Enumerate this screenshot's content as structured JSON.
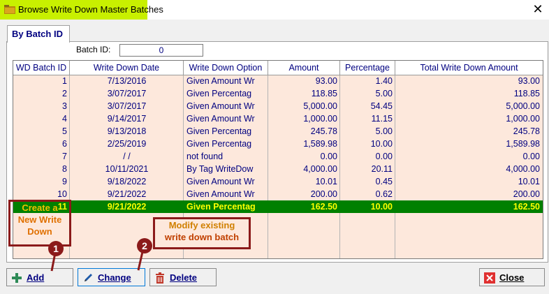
{
  "window": {
    "title": "Browse Write Down Master Batches",
    "close_symbol": "✕"
  },
  "tabs": [
    {
      "label": "By Batch ID",
      "active": true
    }
  ],
  "filter": {
    "batch_id_label": "Batch ID:",
    "batch_id_value": "0"
  },
  "grid": {
    "columns": [
      "WD Batch ID",
      "Write Down Date",
      "Write Down Option",
      "Amount",
      "Percentage",
      "Total Write Down Amount"
    ],
    "rows": [
      {
        "id": "1",
        "date": "7/13/2016",
        "option": "Given Amount Wr",
        "amount": "93.00",
        "percentage": "1.40",
        "total": "93.00"
      },
      {
        "id": "2",
        "date": "3/07/2017",
        "option": "Given Percentag",
        "amount": "118.85",
        "percentage": "5.00",
        "total": "118.85"
      },
      {
        "id": "3",
        "date": "3/07/2017",
        "option": "Given Amount Wr",
        "amount": "5,000.00",
        "percentage": "54.45",
        "total": "5,000.00"
      },
      {
        "id": "4",
        "date": "9/14/2017",
        "option": "Given Amount Wr",
        "amount": "1,000.00",
        "percentage": "11.15",
        "total": "1,000.00"
      },
      {
        "id": "5",
        "date": "9/13/2018",
        "option": "Given Percentag",
        "amount": "245.78",
        "percentage": "5.00",
        "total": "245.78"
      },
      {
        "id": "6",
        "date": "2/25/2019",
        "option": "Given Percentag",
        "amount": "1,589.98",
        "percentage": "10.00",
        "total": "1,589.98"
      },
      {
        "id": "7",
        "date": " /  /",
        "option": "not found",
        "amount": "0.00",
        "percentage": "0.00",
        "total": "0.00"
      },
      {
        "id": "8",
        "date": "10/11/2021",
        "option": "By Tag WriteDow",
        "amount": "4,000.00",
        "percentage": "20.11",
        "total": "4,000.00"
      },
      {
        "id": "9",
        "date": "9/18/2022",
        "option": "Given Amount Wr",
        "amount": "10.01",
        "percentage": "0.45",
        "total": "10.01"
      },
      {
        "id": "10",
        "date": "9/21/2022",
        "option": "Given Amount Wr",
        "amount": "200.00",
        "percentage": "0.62",
        "total": "200.00"
      },
      {
        "id": "11",
        "date": "9/21/2022",
        "option": "Given Percentag",
        "amount": "162.50",
        "percentage": "10.00",
        "total": "162.50",
        "selected": true
      }
    ]
  },
  "callouts": {
    "create": {
      "line1": "Create a",
      "line2": "New Write",
      "line3": "Down",
      "badge": "1"
    },
    "modify": {
      "line1": "Modify existing",
      "line2": "write down batch",
      "badge": "2"
    }
  },
  "buttons": {
    "add": "Add",
    "change": "Change",
    "delete": "Delete",
    "close": "Close"
  },
  "colors": {
    "title_highlight": "#c8f000",
    "grid_background": "#fde8dc",
    "selected_row": "#008000",
    "selected_text": "#ffff00",
    "grid_text": "#000080",
    "callout_border": "#8b1a1a"
  },
  "icons": {
    "app": "folder-icon",
    "add": "plus-icon",
    "change": "pencil-icon",
    "delete": "trash-icon",
    "close": "close-icon"
  }
}
